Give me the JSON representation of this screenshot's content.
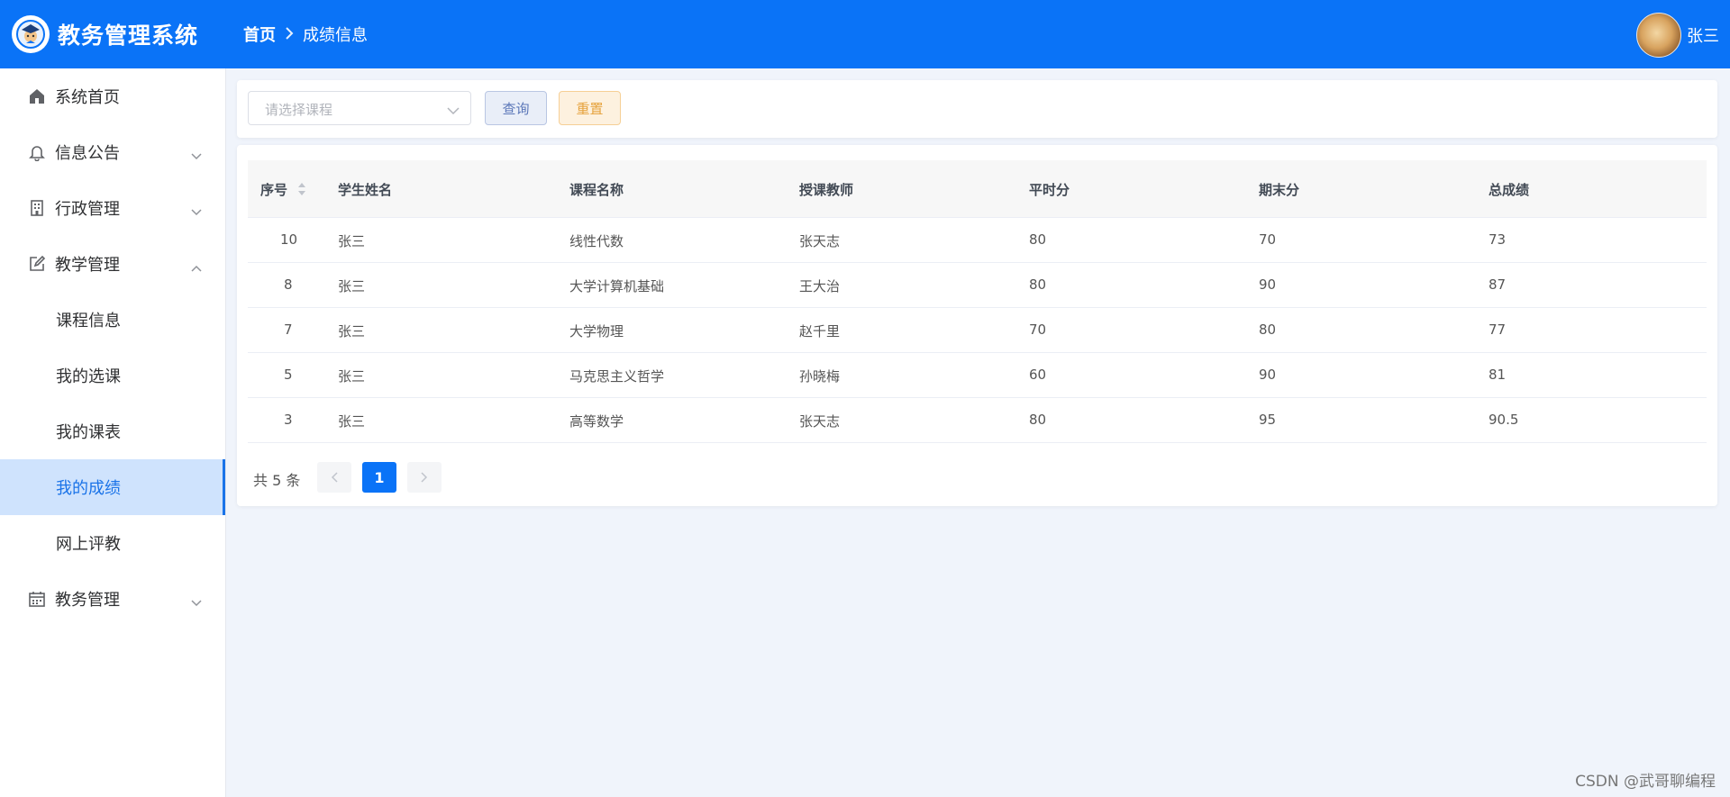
{
  "header": {
    "app_title": "教务管理系统",
    "breadcrumb_home": "首页",
    "breadcrumb_current": "成绩信息",
    "user_name": "张三"
  },
  "sidebar": {
    "items": [
      {
        "label": "系统首页",
        "icon": "home-icon"
      },
      {
        "label": "信息公告",
        "icon": "bell-icon",
        "arrow": "chevron-down"
      },
      {
        "label": "行政管理",
        "icon": "building-icon",
        "arrow": "chevron-down"
      },
      {
        "label": "教学管理",
        "icon": "edit-icon",
        "arrow": "chevron-up"
      }
    ],
    "sub_items": [
      {
        "label": "课程信息"
      },
      {
        "label": "我的选课"
      },
      {
        "label": "我的课表"
      },
      {
        "label": "我的成绩",
        "active": true
      },
      {
        "label": "网上评教"
      }
    ],
    "last_item": {
      "label": "教务管理",
      "icon": "calendar-icon",
      "arrow": "chevron-down"
    }
  },
  "search": {
    "course_placeholder": "请选择课程",
    "query_label": "查询",
    "reset_label": "重置"
  },
  "table": {
    "headers": [
      "序号",
      "学生姓名",
      "课程名称",
      "授课教师",
      "平时分",
      "期末分",
      "总成绩"
    ],
    "rows": [
      [
        "10",
        "张三",
        "线性代数",
        "张天志",
        "80",
        "70",
        "73"
      ],
      [
        "8",
        "张三",
        "大学计算机基础",
        "王大治",
        "80",
        "90",
        "87"
      ],
      [
        "7",
        "张三",
        "大学物理",
        "赵千里",
        "70",
        "80",
        "77"
      ],
      [
        "5",
        "张三",
        "马克思主义哲学",
        "孙晓梅",
        "60",
        "90",
        "81"
      ],
      [
        "3",
        "张三",
        "高等数学",
        "张天志",
        "80",
        "95",
        "90.5"
      ]
    ]
  },
  "pagination": {
    "total_text": "共 5 条",
    "current_page": "1"
  },
  "watermark": "CSDN @武哥聊编程",
  "colors": {
    "header_bg": "#0a73f7",
    "active_menu_bg": "#cfe3fd",
    "active_menu_text": "#1a73e8"
  }
}
